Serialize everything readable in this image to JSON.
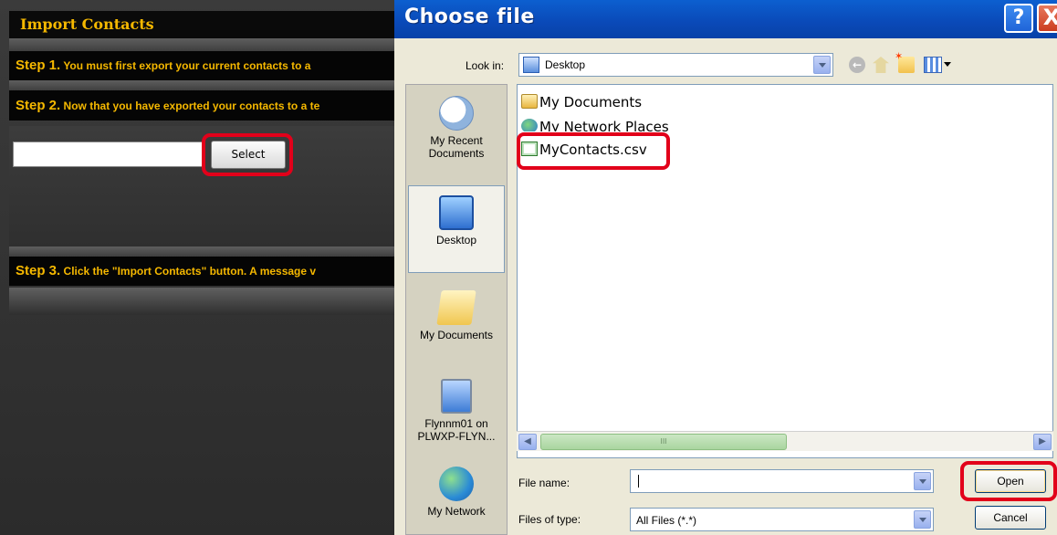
{
  "import_panel": {
    "header": "Import Contacts",
    "step1": {
      "num": "Step 1.",
      "text": "You must first export your current contacts to a"
    },
    "step2": {
      "num": "Step 2.",
      "text": "Now that you have exported your contacts to a te"
    },
    "select_button": "Select",
    "step3": {
      "num": "Step 3.",
      "text": "Click the \"Import Contacts\" button. A message v"
    }
  },
  "dialog": {
    "title": "Choose file",
    "help_glyph": "?",
    "close_glyph": "X",
    "look_in_label": "Look in:",
    "look_in_value": "Desktop",
    "places": {
      "recent": "My Recent Documents",
      "desktop": "Desktop",
      "my_documents": "My Documents",
      "my_computer": "Flynnm01 on PLWXP-FLYN...",
      "network": "My Network"
    },
    "files": [
      "My Documents",
      "My Network Places",
      "MyContacts.csv"
    ],
    "scroll_thumb_grip": "III",
    "file_name_label": "File name:",
    "file_name_value": "",
    "files_of_type_label": "Files of type:",
    "files_of_type_value": "All Files (*.*)",
    "open_button": "Open",
    "cancel_button": "Cancel"
  },
  "colors": {
    "highlight_ring": "#e2001a",
    "title_bar": "#0a49b7",
    "step_text": "#f5b800"
  },
  "icons": [
    "clock-icon",
    "desktop-icon",
    "folder-icon",
    "computer-icon",
    "network-globe-icon",
    "back-icon",
    "up-folder-icon",
    "new-folder-icon",
    "views-menu-icon",
    "excel-file-icon"
  ]
}
